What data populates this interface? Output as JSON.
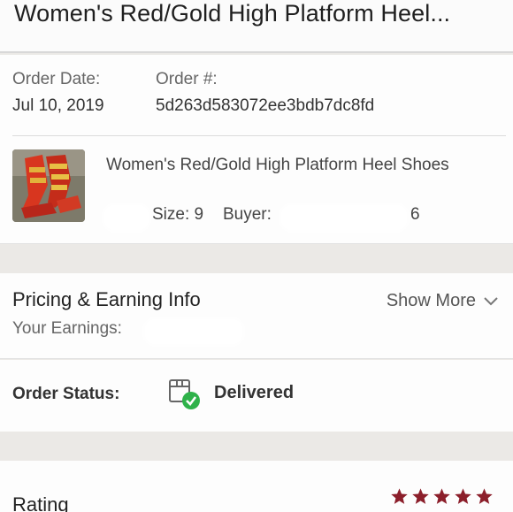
{
  "header": {
    "title": "Women's Red/Gold High Platform Heel..."
  },
  "order": {
    "date_label": "Order Date:",
    "date_value": "Jul 10, 2019",
    "number_label": "Order #:",
    "number_value": "5d263d583072ee3bdb7dc8fd"
  },
  "product": {
    "name": "Women's Red/Gold High Platform Heel Shoes",
    "size_text": "Size: 9",
    "buyer_label": "Buyer:",
    "buyer_suffix": "6"
  },
  "pricing": {
    "heading": "Pricing & Earning Info",
    "show_more": "Show More",
    "earnings_label": "Your Earnings:"
  },
  "status": {
    "label": "Order Status:",
    "value": "Delivered",
    "icon": "package-delivered-icon"
  },
  "rating": {
    "label": "Rating",
    "stars": 5,
    "star_color": "#8c1f2b"
  },
  "colors": {
    "accent": "#8c1f2b",
    "check_green": "#2fb24a"
  }
}
